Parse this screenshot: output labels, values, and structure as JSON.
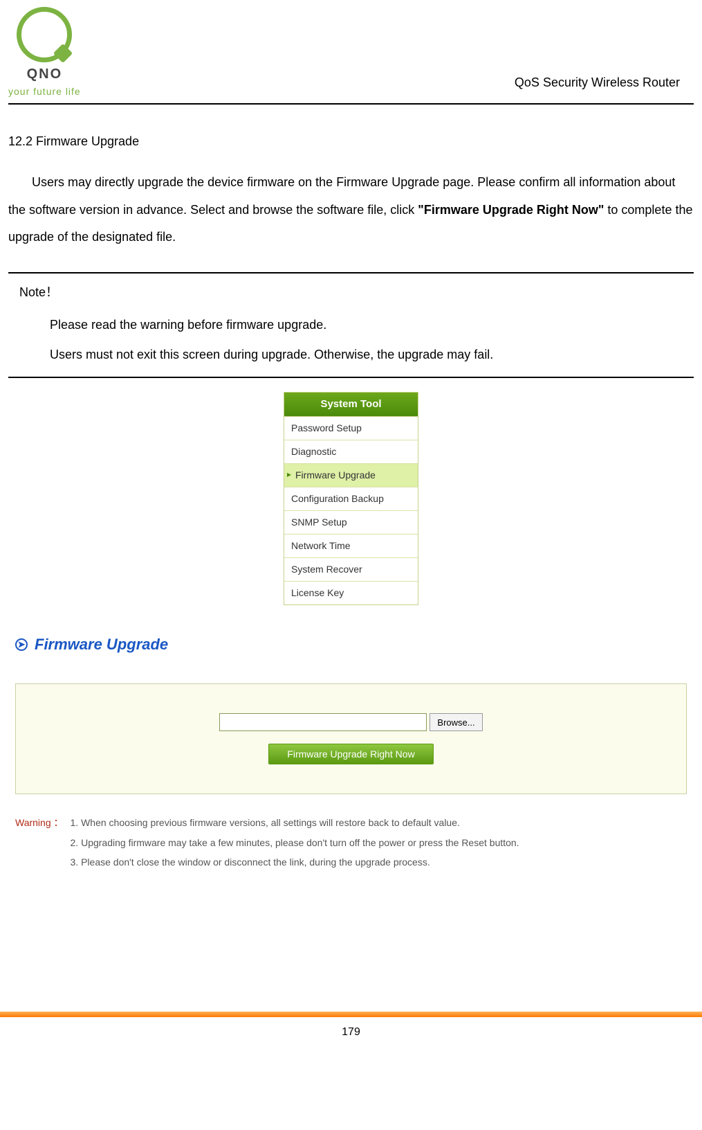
{
  "header": {
    "brand": "QNO",
    "tagline": "your future life",
    "product_name": "QoS Security Wireless Router"
  },
  "section": {
    "title": "12.2 Firmware Upgrade",
    "paragraph_pre": "Users may directly upgrade the device firmware on the Firmware Upgrade page. Please confirm all information about the software version in advance. Select and browse the software file, click ",
    "paragraph_bold": "\"Firmware Upgrade Right Now\"",
    "paragraph_post": " to complete the upgrade of the designated file."
  },
  "note": {
    "title": "Note！",
    "lines": [
      "Please read the warning before firmware upgrade.",
      "Users must not exit this screen during upgrade. Otherwise, the upgrade may fail."
    ]
  },
  "menu": {
    "title": "System Tool",
    "items": [
      "Password Setup",
      "Diagnostic",
      "Firmware Upgrade",
      "Configuration Backup",
      "SNMP Setup",
      "Network Time",
      "System Recover",
      "License Key"
    ],
    "active_index": 2
  },
  "panel": {
    "heading": "Firmware Upgrade",
    "browse_label": "Browse...",
    "upgrade_label": "Firmware Upgrade Right Now"
  },
  "warning": {
    "label": "Warning ：",
    "items": [
      "1. When choosing previous firmware versions, all settings will restore back to default value.",
      "2. Upgrading firmware may take a few minutes, please don't turn off the power or press the Reset button.",
      "3. Please don't close the window or disconnect the link, during the upgrade process."
    ]
  },
  "page_number": "179"
}
